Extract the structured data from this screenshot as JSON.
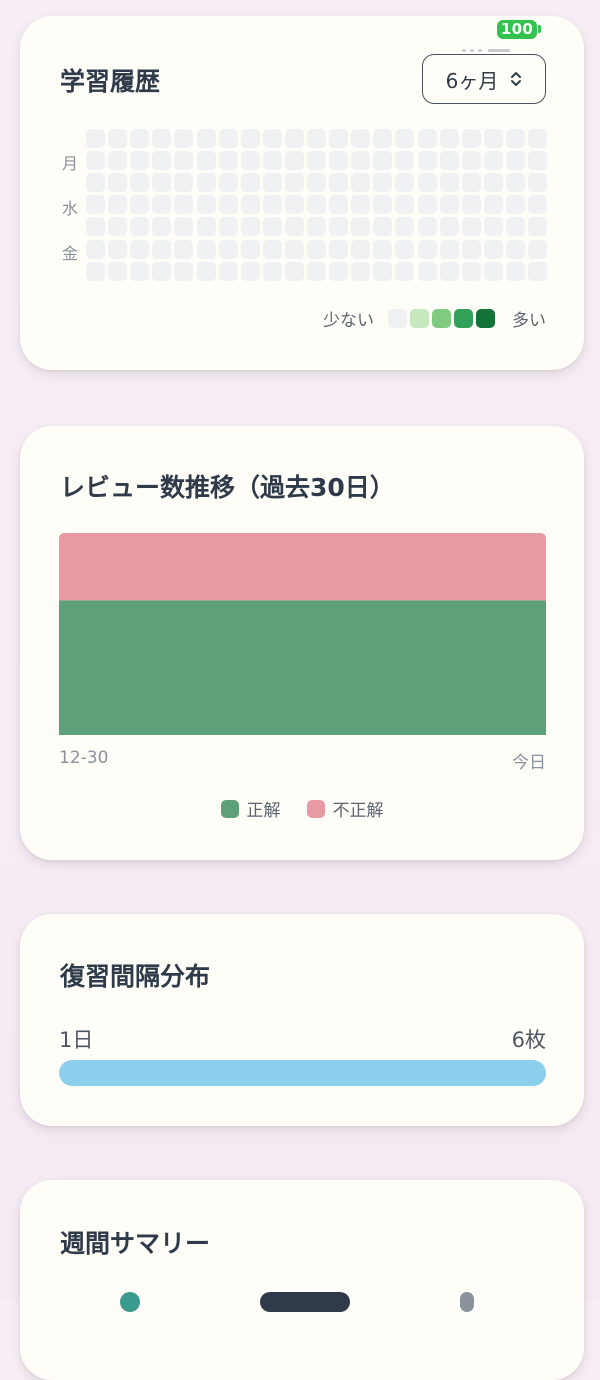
{
  "status": {
    "battery": "100"
  },
  "history": {
    "title": "学習履歴",
    "range": "6ヶ月",
    "day_labels": [
      "月",
      "水",
      "金"
    ],
    "legend_less": "少ない",
    "legend_more": "多い",
    "legend_colors": [
      "#eef0f2",
      "#c6e8bf",
      "#7fcb7f",
      "#33a05a",
      "#137238"
    ],
    "empty_color": "#f0f1f3"
  },
  "review": {
    "title": "レビュー数推移（過去30日）",
    "x_start": "12-30",
    "x_end": "今日",
    "legend_correct": "正解",
    "legend_incorrect": "不正解",
    "colors": {
      "correct": "#5ea07a",
      "incorrect": "#e89aa3"
    }
  },
  "interval": {
    "title": "復習間隔分布",
    "bucket_label": "1日",
    "count_label": "6枚",
    "fill_fraction": 1.0,
    "color": "#8acfec"
  },
  "weekly": {
    "title": "週間サマリー"
  },
  "chart_data": {
    "type": "area",
    "x": [
      "12-30",
      "今日"
    ],
    "series": [
      {
        "name": "正解",
        "values": [
          2,
          2
        ]
      },
      {
        "name": "不正解",
        "values": [
          1,
          1
        ]
      }
    ],
    "stacked": true,
    "ylim": [
      0,
      3
    ],
    "grid": false,
    "legend": "bottom-center"
  }
}
